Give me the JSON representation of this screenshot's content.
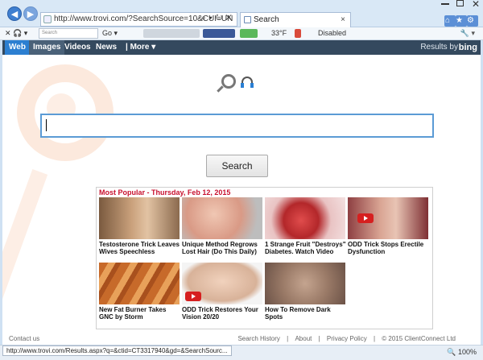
{
  "browser": {
    "address": "http://www.trovi.com/?SearchSource=10&CUI=UN",
    "tab_title": "Search",
    "toolbar": {
      "search_placeholder": "Search",
      "go_label": "Go",
      "temperature": "33°F",
      "disabled_label": "Disabled"
    }
  },
  "results_bar": {
    "tabs": [
      "Web",
      "Images",
      "Videos",
      "News",
      "| More"
    ],
    "results_by": "Results by",
    "bing": "bing"
  },
  "search": {
    "value": "",
    "button": "Search"
  },
  "popular": {
    "title": "Most Popular - Thursday, Feb 12, 2015",
    "items": [
      {
        "caption": "Testosterone Trick Leaves Wives Speechless"
      },
      {
        "caption": "Unique Method Regrows Lost Hair (Do This Daily)"
      },
      {
        "caption": "1 Strange Fruit \"Destroys\" Diabetes. Watch Video"
      },
      {
        "caption": "ODD Trick Stops Erectile Dysfunction"
      },
      {
        "caption": "New Fat Burner Takes GNC by Storm"
      },
      {
        "caption": "ODD Trick Restores Your Vision 20/20"
      },
      {
        "caption": "How To Remove Dark Spots"
      }
    ]
  },
  "footer": {
    "contact": "Contact us",
    "links": [
      "Search History",
      "|",
      "About",
      "|",
      "Privacy Policy",
      "|",
      "© 2015 ClientConnect Ltd"
    ]
  },
  "status": {
    "url": "http://www.trovi.com/Results.aspx?q=&ctid=CT3317940&gd=&SearchSourc...",
    "zoom": "100%"
  }
}
